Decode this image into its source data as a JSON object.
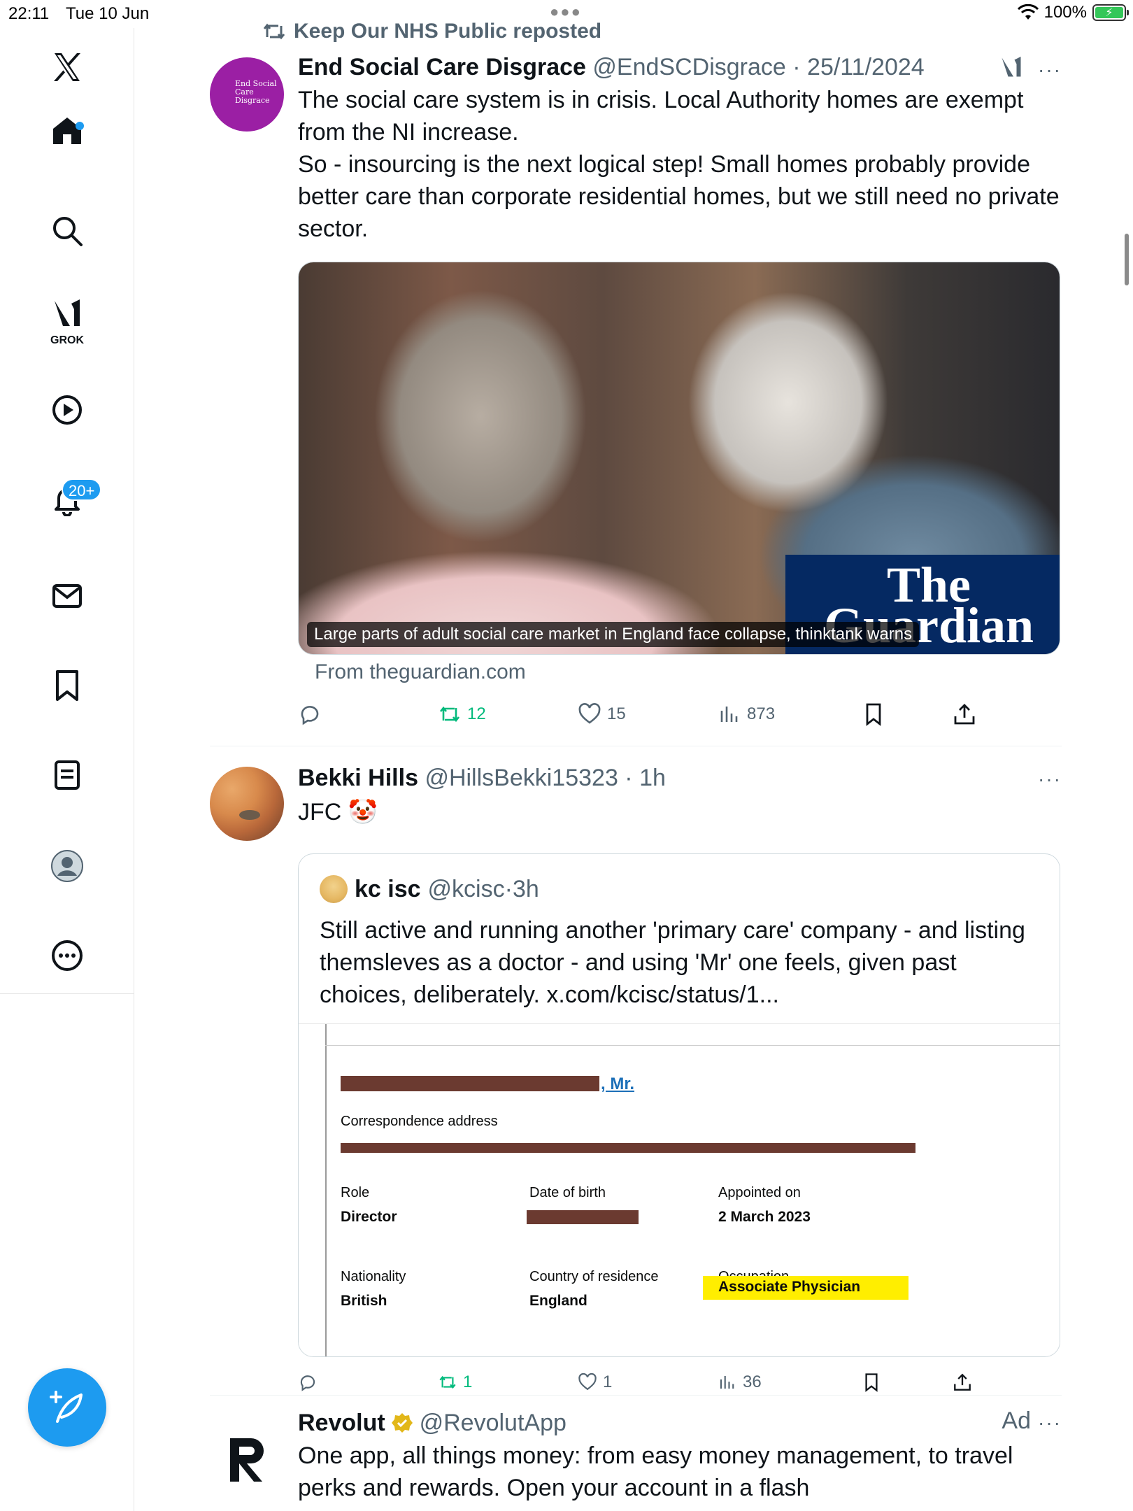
{
  "status_bar": {
    "time": "22:11",
    "date": "Tue 10 Jun",
    "battery": "100%"
  },
  "nav": {
    "grok_label": "GROK",
    "notifications_badge": "20+",
    "items": [
      "x-logo",
      "home",
      "search",
      "grok",
      "video",
      "notifications",
      "messages",
      "bookmarks",
      "lists",
      "profile",
      "more"
    ]
  },
  "tweet1": {
    "repost_text": "Keep Our NHS Public reposted",
    "name": "End Social Care Disgrace",
    "handle": "@EndSCDisgrace",
    "date": "25/11/2024",
    "avatar_text": "End Social Care Disgrace",
    "text_1": "The social care system is in crisis. Local Authority homes are exempt from the NI increase.",
    "text_2": "So - insourcing is the next logical step! Small homes probably provide better care than corporate residential homes, but we still need no private sector.",
    "card_caption": "Large parts of adult social care market in England face collapse, thinktank warns",
    "card_brand": "The Guardian",
    "card_source": "From theguardian.com",
    "actions": {
      "replies": "",
      "reposts": "12",
      "likes": "15",
      "views": "873"
    }
  },
  "tweet2": {
    "name": "Bekki Hills",
    "handle": "@HillsBekki15323",
    "time": "1h",
    "text": "JFC 🤡",
    "quote": {
      "name": "kc isc",
      "handle": "@kcisc",
      "time": "3h",
      "text": "Still active and running another 'primary care' company - and listing themsleves as a doctor - and using 'Mr' one feels, given past choices, deliberately. x.com/kcisc/status/1...",
      "doc": {
        "name_suffix": ", Mr.",
        "correspondence_label": "Correspondence address",
        "role_label": "Role",
        "role_value": "Director",
        "dob_label": "Date of birth",
        "appointed_label": "Appointed on",
        "appointed_value": "2 March 2023",
        "nationality_label": "Nationality",
        "nationality_value": "British",
        "residence_label": "Country of residence",
        "residence_value": "England",
        "occupation_label": "Occupation",
        "occupation_value": "Associate Physician"
      }
    },
    "actions": {
      "replies": "",
      "reposts": "1",
      "likes": "1",
      "views": "36"
    }
  },
  "tweet3": {
    "name": "Revolut",
    "handle": "@RevolutApp",
    "ad_label": "Ad",
    "text": "One app, all things money: from easy money management, to travel perks and rewards. Open your account in a flash"
  },
  "colors": {
    "accent": "#1d9bf0",
    "repost_green": "#00ba7c",
    "muted": "#536471",
    "guardian_blue": "#052962",
    "avatar_purple": "#9b1fa4"
  }
}
